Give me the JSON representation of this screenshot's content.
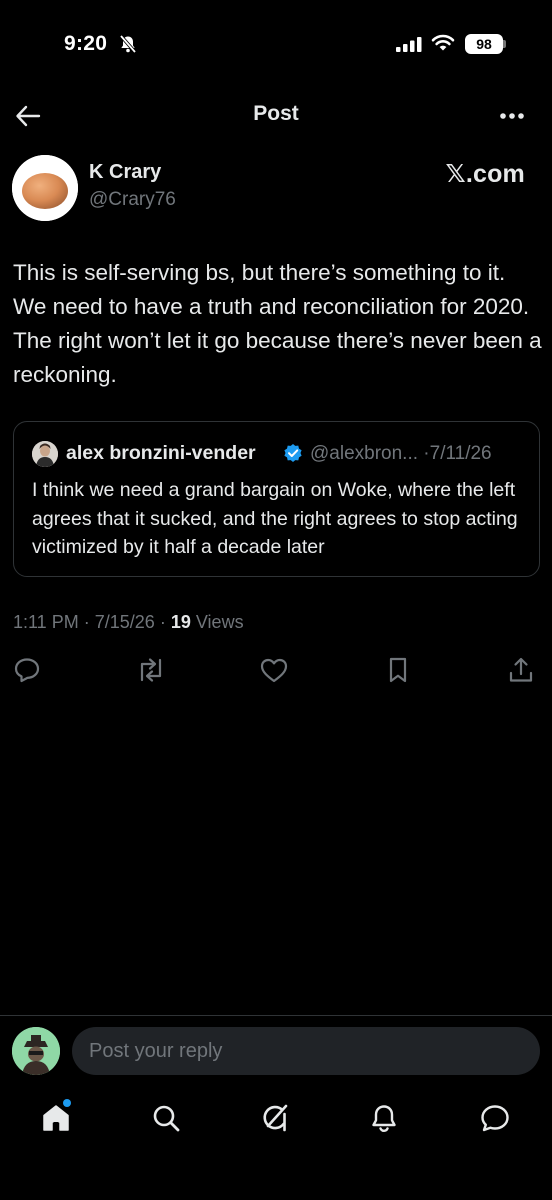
{
  "status_bar": {
    "time": "9:20",
    "battery": "98"
  },
  "header": {
    "title": "Post"
  },
  "post": {
    "author_name": "K Crary",
    "author_handle": "@Crary76",
    "source": "𝕏.com",
    "text": "This is self-serving bs, but there’s something to it. We need to have a truth and reconciliation for 2020. The right won’t let it go because there’s never been a reckoning.",
    "time": "1:11 PM",
    "date": "7/15/26",
    "separator": "·",
    "views_count": "19",
    "views_label": "Views"
  },
  "quoted_post": {
    "author_name": "alex bronzini-vender",
    "author_handle": "@alexbron...",
    "date": "7/11/26",
    "separator": "·",
    "text": "I think we need a grand bargain on Woke, where the left agrees that it sucked, and the right agrees to stop acting victimized by it half a decade later"
  },
  "reply": {
    "placeholder": "Post your reply"
  },
  "colors": {
    "background": "#000000",
    "text_primary": "#e7e9ea",
    "text_secondary": "#71767b",
    "border": "#2f3336",
    "accent": "#1d9bf0"
  },
  "icons": {
    "back": "arrow-left-icon",
    "more": "more-horizontal-icon",
    "reply": "comment-icon",
    "repost": "repost-icon",
    "like": "heart-icon",
    "bookmark": "bookmark-icon",
    "share": "share-icon",
    "nav_home": "home-icon",
    "nav_search": "search-icon",
    "nav_grok": "grok-icon",
    "nav_notifications": "bell-icon",
    "nav_messages": "messages-icon"
  }
}
